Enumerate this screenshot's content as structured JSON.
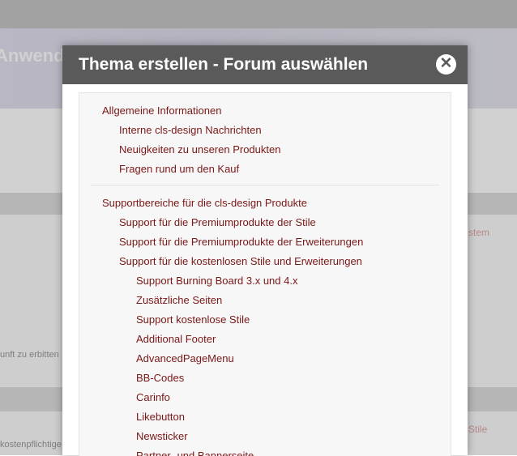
{
  "page": {
    "header_title": "Anwendu",
    "background_left_texts": [
      "unft zu erbitten",
      "kostenpflichtige"
    ],
    "background_right_texts": [
      "stem",
      "Stile"
    ]
  },
  "modal": {
    "title": "Thema erstellen - Forum auswählen",
    "close_icon": "close-icon",
    "sections": [
      {
        "items": [
          {
            "label": "Allgemeine Informationen",
            "level": 0
          },
          {
            "label": "Interne cls-design Nachrichten",
            "level": 1
          },
          {
            "label": "Neuigkeiten zu unseren Produkten",
            "level": 1
          },
          {
            "label": "Fragen rund um den Kauf",
            "level": 1
          }
        ]
      },
      {
        "items": [
          {
            "label": "Supportbereiche für die cls-design Produkte",
            "level": 0
          },
          {
            "label": "Support für die Premiumprodukte der Stile",
            "level": 1
          },
          {
            "label": "Support für die Premiumprodukte der Erweiterungen",
            "level": 1
          },
          {
            "label": "Support für die kostenlosen Stile und Erweiterungen",
            "level": 1
          },
          {
            "label": "Support Burning Board 3.x und 4.x",
            "level": 2
          },
          {
            "label": "Zusätzliche Seiten",
            "level": 2
          },
          {
            "label": "Support kostenlose Stile",
            "level": 2
          },
          {
            "label": "Additional Footer",
            "level": 2
          },
          {
            "label": "AdvancedPageMenu",
            "level": 2
          },
          {
            "label": "BB-Codes",
            "level": 2
          },
          {
            "label": "Carinfo",
            "level": 2
          },
          {
            "label": "Likebutton",
            "level": 2
          },
          {
            "label": "Newsticker",
            "level": 2
          },
          {
            "label": "Partner- und Bannerseite",
            "level": 2
          }
        ]
      }
    ]
  },
  "colors": {
    "link": "#7a1717",
    "modal_header": "#5a5a5a"
  }
}
